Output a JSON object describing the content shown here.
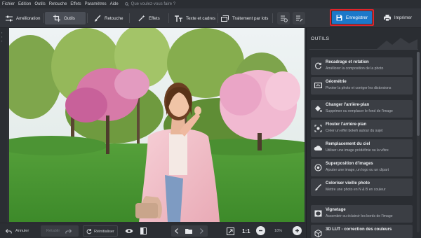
{
  "menu": {
    "items": [
      "Fichier",
      "Edition",
      "Outils",
      "Retouche",
      "Effets",
      "Paramètres",
      "Aide"
    ],
    "search_placeholder": "Que voulez-vous faire ?"
  },
  "toolbar": {
    "tabs": [
      {
        "label": "Amélioration",
        "icon": "sliders-icon"
      },
      {
        "label": "Outils",
        "icon": "crop-icon"
      },
      {
        "label": "Retouche",
        "icon": "brush-icon"
      },
      {
        "label": "Effets",
        "icon": "magic-wand-icon"
      },
      {
        "label": "Texte et cadres",
        "icon": "text-icon"
      },
      {
        "label": "Traitement par lots",
        "icon": "batch-icon"
      }
    ],
    "active_tab": "Outils",
    "save_label": "Enregistrer",
    "print_label": "Imprimer",
    "accent_color": "#1c78c9",
    "highlight_color": "#e0242c"
  },
  "bottombar": {
    "undo_label": "Annuler",
    "redo_label": "Rétablir",
    "reset_label": "Réinitialiser",
    "zoom_11": "1:1",
    "zoom_value": "18%"
  },
  "panel": {
    "title": "OUTILS",
    "tools": [
      {
        "title": "Recadrage et rotation",
        "desc": "Améliorer la composition de la photo",
        "icon": "crop-rotate-icon"
      },
      {
        "title": "Géométrie",
        "desc": "Pivoter la photo et corriger les distorsions",
        "icon": "geometry-icon"
      },
      {
        "title": "Changer l'arrière-plan",
        "desc": "Supprimer ou remplacer le fond de l'image",
        "icon": "fill-bucket-icon"
      },
      {
        "title": "Flouter l'arrière-plan",
        "desc": "Créer un effet bokeh autour du sujet",
        "icon": "blur-icon"
      },
      {
        "title": "Remplacement du ciel",
        "desc": "Utiliser une image prédéfinie ou la vôtre",
        "icon": "sky-icon"
      },
      {
        "title": "Superposition d'images",
        "desc": "Ajouter une image, un logo ou un clipart",
        "icon": "overlay-icon"
      },
      {
        "title": "Coloriser vieille photo",
        "desc": "Mettre une photo en N & B en couleur",
        "icon": "colorize-icon"
      },
      {
        "title": "Vignetage",
        "desc": "Assombrir ou éclaircir les bords de l'image",
        "icon": "vignette-icon"
      },
      {
        "title": "3D LUT - correction des couleurs",
        "desc": "",
        "icon": "lut-icon"
      }
    ]
  }
}
